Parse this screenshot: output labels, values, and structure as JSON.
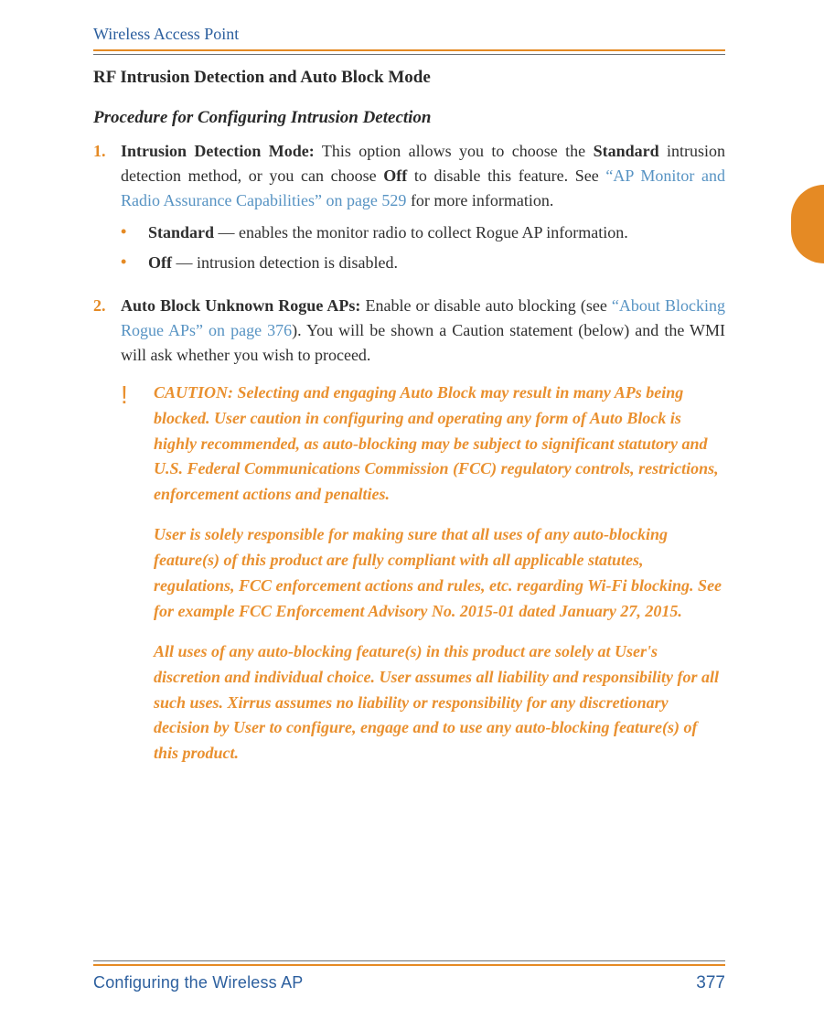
{
  "header": {
    "running_title": "Wireless Access Point"
  },
  "section": {
    "title": "RF Intrusion Detection and Auto Block Mode",
    "subtitle": "Procedure for Configuring Intrusion Detection"
  },
  "steps": [
    {
      "num": "1.",
      "lead_bold": "Intrusion Detection Mode:",
      "body_pre": " This option allows you to choose the ",
      "word_standard": "Standard",
      "body_mid": " intrusion detection method, or you can choose ",
      "word_off": "Off",
      "body_post": " to disable this feature. See ",
      "link_text": "“AP Monitor and Radio Assurance Capabilities” on page 529",
      "body_end": " for more information.",
      "bullets": [
        {
          "term": "Standard",
          "sep": " — ",
          "desc": "enables the monitor radio to collect Rogue AP information."
        },
        {
          "term": "Off",
          "sep": " — ",
          "desc": "intrusion detection is disabled."
        }
      ]
    },
    {
      "num": "2.",
      "lead_bold": "Auto Block Unknown Rogue APs:",
      "body_pre": " Enable or disable auto blocking (see ",
      "link_text": "“About Blocking Rogue APs” on page 376",
      "body_post": "). You will be shown a Caution statement (below) and the WMI will ask whether you wish to proceed."
    }
  ],
  "caution": {
    "bang": "!",
    "paragraphs": [
      "CAUTION: Selecting and engaging Auto Block may result in many APs being blocked.  User caution in configuring and operating any form of Auto Block is highly recommended, as auto-blocking may be subject to significant statutory and U.S. Federal Communications Commission (FCC) regulatory controls, restrictions, enforcement actions and penalties.",
      "User is solely responsible for making sure that all uses of any auto-blocking feature(s) of this product are fully compliant with all applicable statutes, regulations, FCC enforcement actions and rules, etc. regarding Wi-Fi blocking. See for example FCC Enforcement Advisory No. 2015-01 dated January 27, 2015.",
      "All uses of any auto-blocking feature(s) in this product are solely at User's discretion and individual choice. User assumes all liability and responsibility for all such uses.  Xirrus assumes no liability or responsibility for any discretionary decision by User to configure, engage and to use any auto-blocking feature(s) of this product."
    ]
  },
  "footer": {
    "left": "Configuring the Wireless AP",
    "right": "377"
  }
}
